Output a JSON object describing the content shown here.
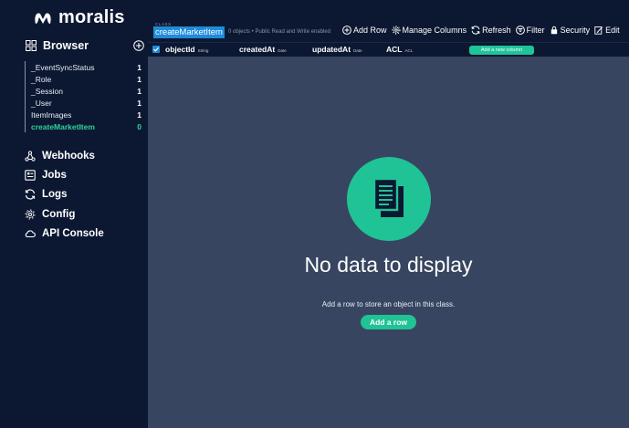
{
  "brand": {
    "name": "moralis"
  },
  "sidebar": {
    "browser_label": "Browser",
    "classes": [
      {
        "name": "_EventSyncStatus",
        "count": "1",
        "active": false
      },
      {
        "name": "_Role",
        "count": "1",
        "active": false
      },
      {
        "name": "_Session",
        "count": "1",
        "active": false
      },
      {
        "name": "_User",
        "count": "1",
        "active": false
      },
      {
        "name": "ItemImages",
        "count": "1",
        "active": false
      },
      {
        "name": "createMarketItem",
        "count": "0",
        "active": true
      }
    ],
    "nav": [
      {
        "label": "Webhooks",
        "icon": "webhook-icon"
      },
      {
        "label": "Jobs",
        "icon": "jobs-icon"
      },
      {
        "label": "Logs",
        "icon": "logs-icon"
      },
      {
        "label": "Config",
        "icon": "gear-icon"
      },
      {
        "label": "API Console",
        "icon": "cloud-icon"
      }
    ]
  },
  "header": {
    "caption": "CLASS",
    "class_name": "createMarketItem",
    "meta": "0 objects • Public Read and Write enabled",
    "actions": [
      {
        "label": "Add Row",
        "icon": "plus-circle-icon"
      },
      {
        "label": "Manage Columns",
        "icon": "gear-icon"
      },
      {
        "label": "Refresh",
        "icon": "refresh-icon"
      },
      {
        "label": "Filter",
        "icon": "filter-icon"
      },
      {
        "label": "Security",
        "icon": "lock-icon"
      },
      {
        "label": "Edit",
        "icon": "edit-icon"
      }
    ]
  },
  "columns": [
    {
      "name": "objectId",
      "type": "String"
    },
    {
      "name": "createdAt",
      "type": "Date"
    },
    {
      "name": "updatedAt",
      "type": "Date"
    },
    {
      "name": "ACL",
      "type": "ACL"
    }
  ],
  "add_column_label": "Add a new column",
  "empty": {
    "title": "No data to display",
    "subtitle": "Add a row to store an object in this class.",
    "button": "Add a row"
  },
  "colors": {
    "accent": "#20c395",
    "sidebar": "#0c1832",
    "content": "#374560",
    "highlight": "#1f8bda"
  }
}
